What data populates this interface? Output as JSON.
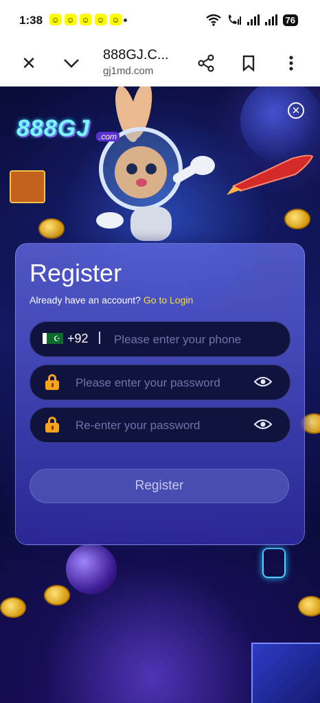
{
  "status_bar": {
    "time": "1:38",
    "battery": "76"
  },
  "browser": {
    "title": "888GJ.C...",
    "url": "gj1md.com"
  },
  "brand": {
    "logo": "888GJ",
    "logo_suffix": ".com"
  },
  "register": {
    "title": "Register",
    "login_prompt": "Already have an account?",
    "login_link": "Go to Login",
    "phone_prefix": "+92",
    "phone_placeholder": "Please enter your phone",
    "password_placeholder": "Please enter your password",
    "repassword_placeholder": "Re-enter your password",
    "submit_label": "Register"
  },
  "colors": {
    "link": "#f7e03c",
    "card": "#5c66dc",
    "field": "#11133f",
    "lock": "#f6a41c"
  }
}
